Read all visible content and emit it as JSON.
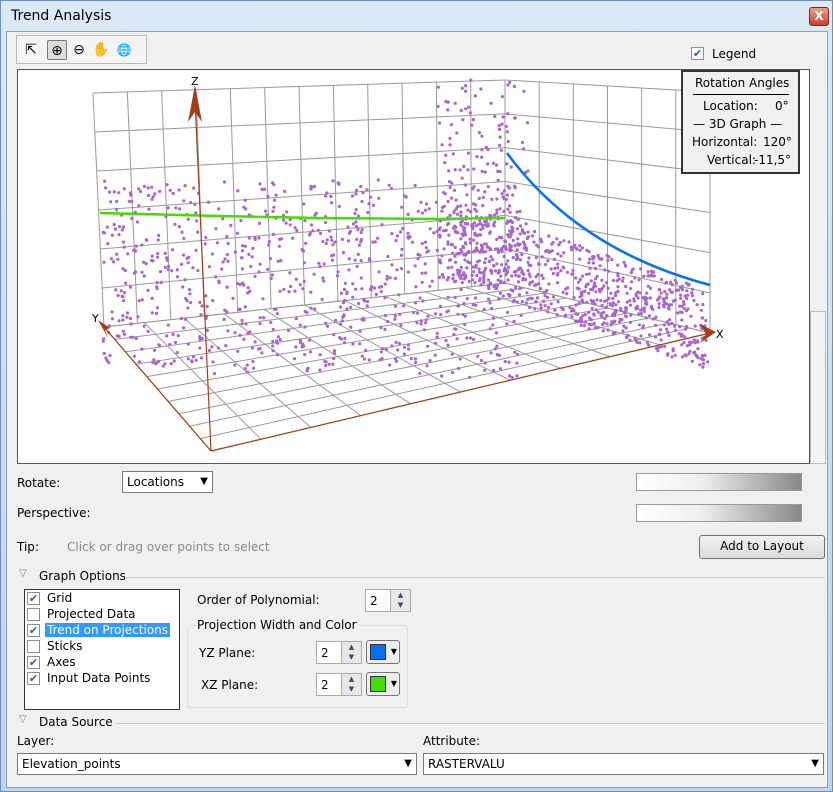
{
  "window": {
    "title": "Trend Analysis",
    "close": "X"
  },
  "toolbar": {
    "tools": [
      {
        "name": "select-tool",
        "glyph": "⇱"
      },
      {
        "name": "zoom-in-tool",
        "glyph": "⊕"
      },
      {
        "name": "zoom-out-tool",
        "glyph": "⊖"
      },
      {
        "name": "pan-tool",
        "glyph": "✋"
      },
      {
        "name": "globe-tool",
        "glyph": "🌐"
      }
    ]
  },
  "legend_toggle": {
    "label": "Legend",
    "checked": true
  },
  "rotation": {
    "title": "Rotation Angles",
    "location_label": "Location:",
    "location": "0°",
    "graph_label": "— 3D Graph —",
    "horizontal_label": "Horizontal:",
    "horizontal": "120°",
    "vertical_label": "Vertical:",
    "vertical": "-11,5°"
  },
  "axes": {
    "x": "X",
    "y": "Y",
    "z": "Z"
  },
  "colors": {
    "points": "#a865cc",
    "yz_trend": "#0a6ef0",
    "xz_trend": "#44dd00",
    "axes": "#a0401a",
    "grid": "#999999"
  },
  "rotate": {
    "label": "Rotate:",
    "value": "Locations"
  },
  "perspective": {
    "label": "Perspective:"
  },
  "tip": {
    "label": "Tip:",
    "text": "Click or drag over points to select"
  },
  "add_to_layout": "Add to Layout",
  "graph_options": {
    "title": "Graph Options",
    "items": [
      {
        "label": "Grid",
        "checked": true
      },
      {
        "label": "Projected Data",
        "checked": false
      },
      {
        "label": "Trend on Projections",
        "checked": true,
        "selected": true
      },
      {
        "label": "Sticks",
        "checked": false
      },
      {
        "label": "Axes",
        "checked": true
      },
      {
        "label": "Input Data Points",
        "checked": true
      }
    ],
    "order_label": "Order of Polynomial:",
    "order": "2",
    "projection_title": "Projection Width and Color",
    "yz_label": "YZ Plane:",
    "yz_width": "2",
    "yz_color": "#0a6ef0",
    "xz_label": "XZ Plane:",
    "xz_width": "2",
    "xz_color": "#44dd00"
  },
  "data_source": {
    "title": "Data Source",
    "layer_label": "Layer:",
    "layer": "Elevation_points",
    "attribute_label": "Attribute:",
    "attribute": "RASTERVALU"
  }
}
